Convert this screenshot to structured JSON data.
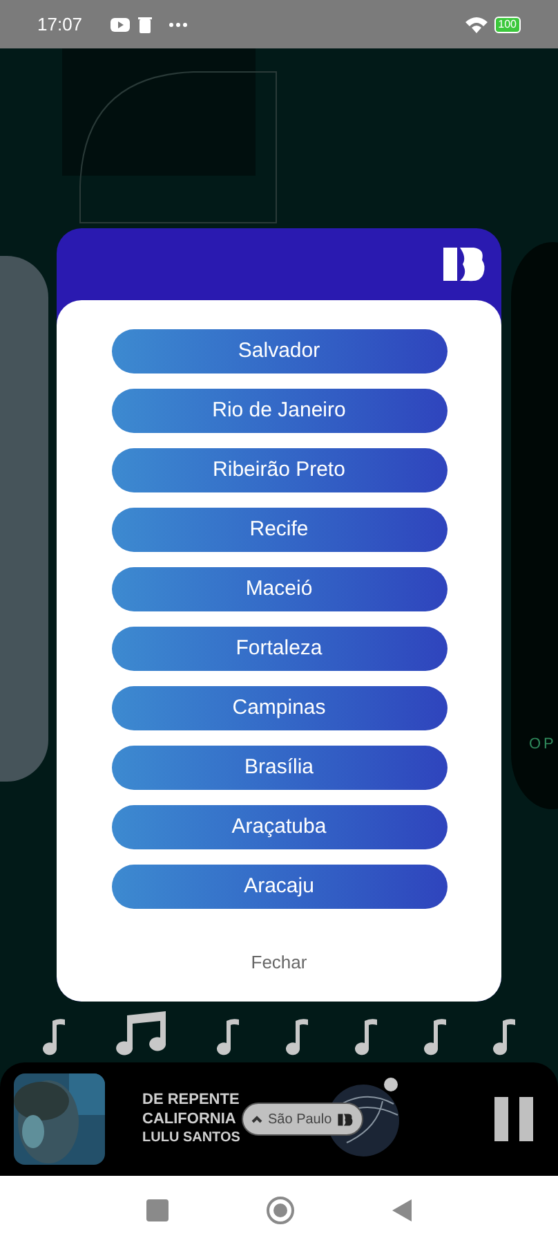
{
  "status_bar": {
    "time": "17:07",
    "battery": "100"
  },
  "background": {
    "side_text": "OP"
  },
  "dialog": {
    "cities": [
      {
        "label": "Salvador"
      },
      {
        "label": "Rio de Janeiro"
      },
      {
        "label": "Ribeirão Preto"
      },
      {
        "label": "Recife"
      },
      {
        "label": "Maceió"
      },
      {
        "label": "Fortaleza"
      },
      {
        "label": "Campinas"
      },
      {
        "label": "Brasília"
      },
      {
        "label": "Araçatuba"
      },
      {
        "label": "Aracaju"
      }
    ],
    "close": "Fechar"
  },
  "player": {
    "title": "DE REPENTE CALIFORNIA",
    "artist": "LULU SANTOS",
    "station": "São Paulo",
    "playing": true
  }
}
